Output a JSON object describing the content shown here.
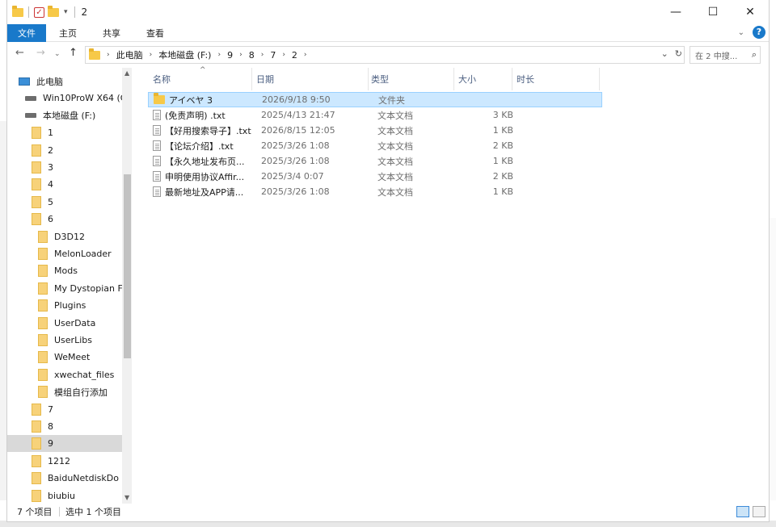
{
  "window": {
    "title": "2",
    "controls": {
      "minimize": "—",
      "maximize": "☐",
      "close": "✕"
    }
  },
  "ribbon": {
    "tabs": [
      "文件",
      "主页",
      "共享",
      "查看"
    ]
  },
  "address": {
    "crumbs": [
      "此电脑",
      "本地磁盘 (F:)",
      "9",
      "8",
      "7",
      "2"
    ],
    "search_placeholder": "在 2 中搜..."
  },
  "columns": {
    "name": "名称",
    "date": "日期",
    "type": "类型",
    "size": "大小",
    "length": "时长"
  },
  "files": [
    {
      "name": "アイベヤ 3",
      "date": "2026/9/18 9:50",
      "type": "文件夹",
      "size": "",
      "kind": "folder"
    },
    {
      "name": "(免责声明) .txt",
      "date": "2025/4/13 21:47",
      "type": "文本文档",
      "size": "3 KB",
      "kind": "txt"
    },
    {
      "name": "【好用搜索导子】.txt",
      "date": "2026/8/15 12:05",
      "type": "文本文档",
      "size": "1 KB",
      "kind": "txt"
    },
    {
      "name": "【论坛介绍】.txt",
      "date": "2025/3/26 1:08",
      "type": "文本文档",
      "size": "2 KB",
      "kind": "txt"
    },
    {
      "name": "【永久地址发布页...",
      "date": "2025/3/26 1:08",
      "type": "文本文档",
      "size": "1 KB",
      "kind": "txt"
    },
    {
      "name": "申明使用协议Affir...",
      "date": "2025/3/4 0:07",
      "type": "文本文档",
      "size": "2 KB",
      "kind": "txt"
    },
    {
      "name": "最新地址及APP请...",
      "date": "2025/3/26 1:08",
      "type": "文本文档",
      "size": "1 KB",
      "kind": "txt"
    }
  ],
  "tree": [
    {
      "label": "此电脑",
      "icon": "pc",
      "indent": 0,
      "caret": ""
    },
    {
      "label": "Win10ProW X64 (C",
      "icon": "drive",
      "indent": 1,
      "caret": ""
    },
    {
      "label": "本地磁盘 (F:)",
      "icon": "drive",
      "indent": 1,
      "caret": ""
    },
    {
      "label": "1",
      "icon": "folder",
      "indent": 2,
      "caret": ""
    },
    {
      "label": "2",
      "icon": "folder",
      "indent": 2,
      "caret": ""
    },
    {
      "label": "3",
      "icon": "folder",
      "indent": 2,
      "caret": ""
    },
    {
      "label": "4",
      "icon": "folder",
      "indent": 2,
      "caret": ""
    },
    {
      "label": "5",
      "icon": "folder",
      "indent": 2,
      "caret": ""
    },
    {
      "label": "6",
      "icon": "folder",
      "indent": 2,
      "caret": ""
    },
    {
      "label": "D3D12",
      "icon": "folder",
      "indent": 3,
      "caret": ""
    },
    {
      "label": "MelonLoader",
      "icon": "folder",
      "indent": 3,
      "caret": ""
    },
    {
      "label": "Mods",
      "icon": "folder",
      "indent": 3,
      "caret": ""
    },
    {
      "label": "My Dystopian F",
      "icon": "folder",
      "indent": 3,
      "caret": ""
    },
    {
      "label": "Plugins",
      "icon": "folder",
      "indent": 3,
      "caret": ""
    },
    {
      "label": "UserData",
      "icon": "folder",
      "indent": 3,
      "caret": ""
    },
    {
      "label": "UserLibs",
      "icon": "folder",
      "indent": 3,
      "caret": ""
    },
    {
      "label": "WeMeet",
      "icon": "folder",
      "indent": 3,
      "caret": ""
    },
    {
      "label": "xwechat_files",
      "icon": "folder",
      "indent": 3,
      "caret": ""
    },
    {
      "label": "模组自行添加",
      "icon": "folder",
      "indent": 3,
      "caret": ""
    },
    {
      "label": "7",
      "icon": "folder",
      "indent": 2,
      "caret": ""
    },
    {
      "label": "8",
      "icon": "folder",
      "indent": 2,
      "caret": ""
    },
    {
      "label": "9",
      "icon": "folder",
      "indent": 2,
      "caret": "",
      "selected": true
    },
    {
      "label": "1212",
      "icon": "folder",
      "indent": 2,
      "caret": ""
    },
    {
      "label": "BaiduNetdiskDo",
      "icon": "folder",
      "indent": 2,
      "caret": ""
    },
    {
      "label": "biubiu",
      "icon": "folder",
      "indent": 2,
      "caret": ""
    }
  ],
  "status": {
    "count": "7 个项目",
    "selected": "选中 1 个项目"
  },
  "colors": {
    "accent": "#1979ca",
    "selection": "#cce8ff",
    "folder": "#f7d27a"
  }
}
